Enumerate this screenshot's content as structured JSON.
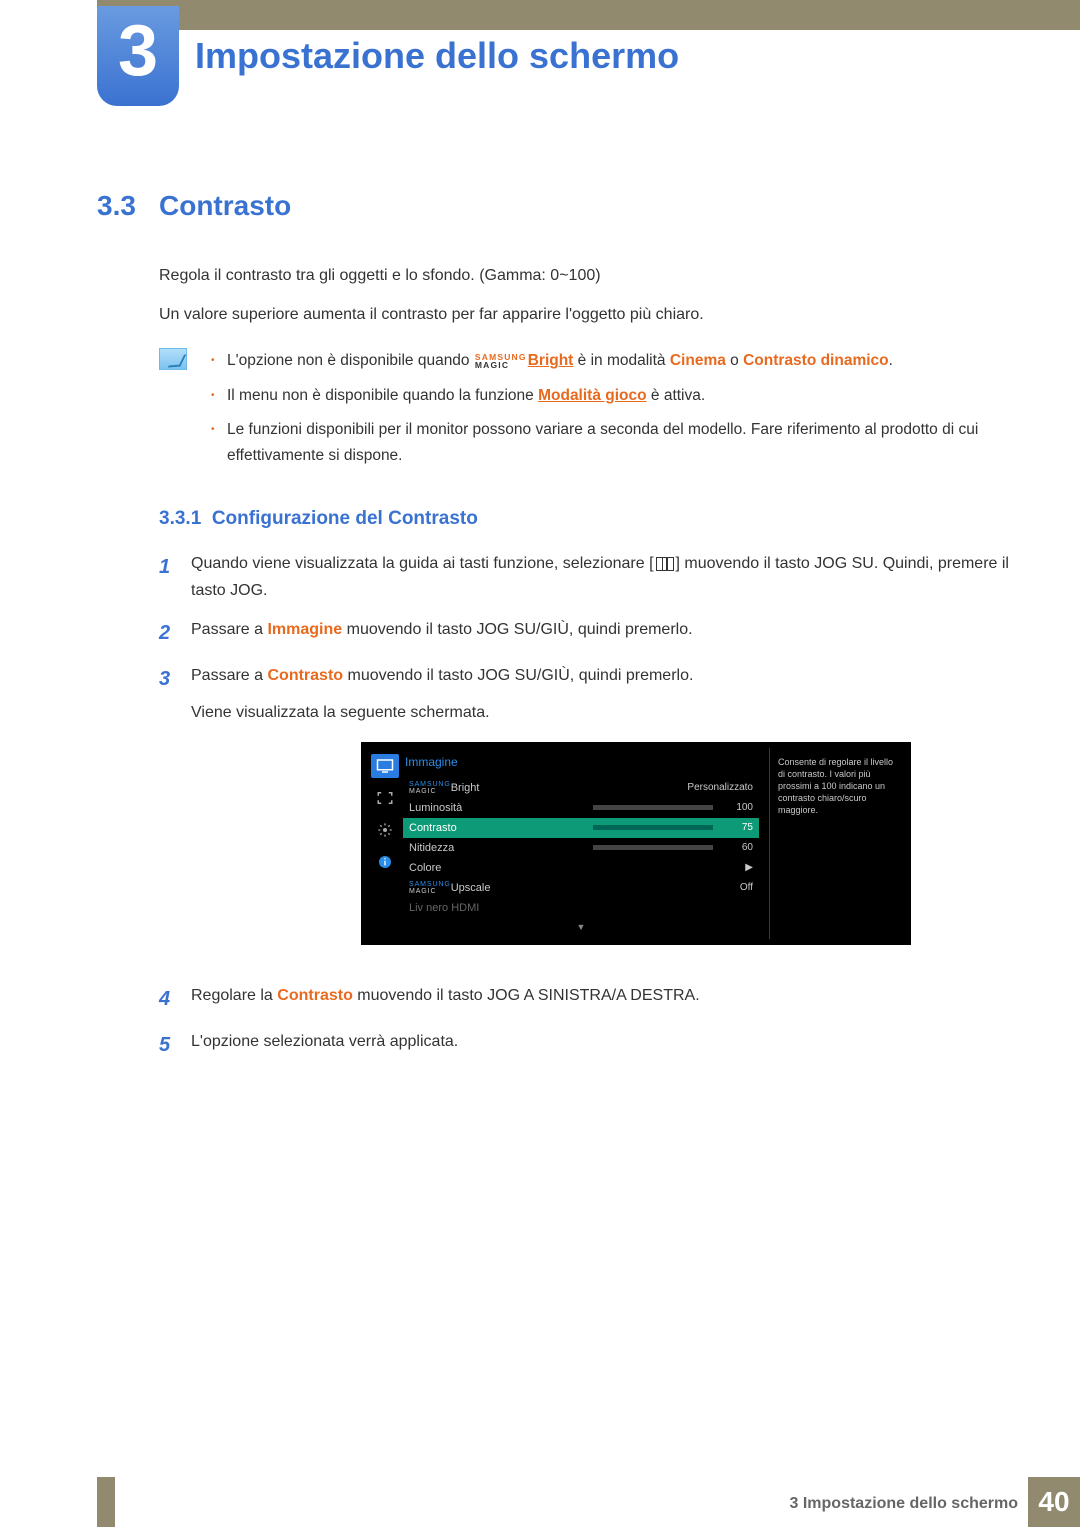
{
  "chapter": {
    "num": "3",
    "title": "Impostazione dello schermo"
  },
  "section": {
    "num": "3.3",
    "title": "Contrasto"
  },
  "intro": {
    "p1": "Regola il contrasto tra gli oggetti e lo sfondo. (Gamma: 0~100)",
    "p2": "Un valore superiore aumenta il contrasto per far apparire l'oggetto più chiaro."
  },
  "notes": {
    "n1_a": "L'opzione non è disponibile quando ",
    "n1_bright": "Bright",
    "n1_b": " è in modalità ",
    "n1_cinema": "Cinema",
    "n1_o": " o ",
    "n1_cd": "Contrasto dinamico",
    "n1_end": ".",
    "n2_a": "Il menu non è disponibile quando la funzione ",
    "n2_link": "Modalità gioco",
    "n2_b": " è attiva.",
    "n3": "Le funzioni disponibili per il monitor possono variare a seconda del modello. Fare riferimento al prodotto di cui effettivamente si dispone."
  },
  "subsection": {
    "num": "3.3.1",
    "title": "Configurazione del Contrasto"
  },
  "steps": {
    "s1a": "Quando viene visualizzata la guida ai tasti funzione, selezionare [",
    "s1b": "] muovendo il tasto JOG SU. Quindi, premere il tasto JOG.",
    "s2a": "Passare a ",
    "s2k": "Immagine",
    "s2b": " muovendo il tasto JOG SU/GIÙ, quindi premerlo.",
    "s3a": "Passare a ",
    "s3k": "Contrasto",
    "s3b": " muovendo il tasto JOG SU/GIÙ, quindi premerlo.",
    "s3c": "Viene visualizzata la seguente schermata.",
    "s4a": "Regolare la ",
    "s4k": "Contrasto",
    "s4b": " muovendo il tasto JOG A SINISTRA/A DESTRA.",
    "s5": "L'opzione selezionata verrà applicata."
  },
  "osd": {
    "title": "Immagine",
    "rows": {
      "r1": {
        "label": "Bright",
        "value": "Personalizzato"
      },
      "r2": {
        "label": "Luminosità",
        "value": "100"
      },
      "r3": {
        "label": "Contrasto",
        "value": "75"
      },
      "r4": {
        "label": "Nitidezza",
        "value": "60"
      },
      "r5": {
        "label": "Colore",
        "value": "▶"
      },
      "r6": {
        "label": "Upscale",
        "value": "Off"
      },
      "r7": {
        "label": "Liv nero HDMI"
      }
    },
    "help": "Consente di regolare il livello di contrasto. I valori più prossimi a 100 indicano un contrasto chiaro/scuro maggiore."
  },
  "magic": {
    "top": "SAMSUNG",
    "bot": "MAGIC"
  },
  "footer": {
    "text": "3 Impostazione dello schermo",
    "page": "40"
  }
}
